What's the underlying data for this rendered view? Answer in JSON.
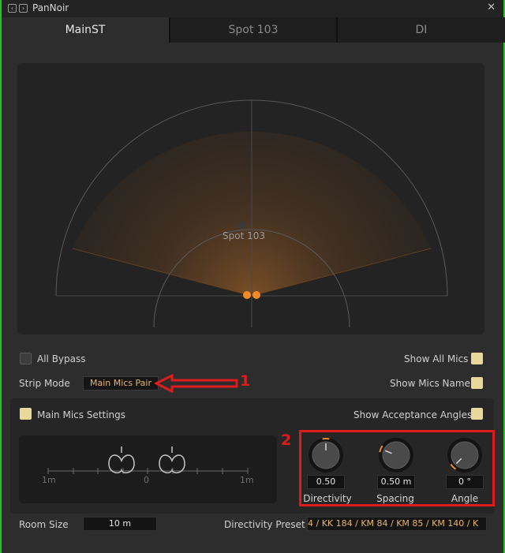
{
  "window": {
    "title": "PanNoir",
    "close_glyph": "✕",
    "nav_prev_glyph": "‹",
    "nav_next_glyph": "›"
  },
  "tabs": [
    {
      "label": "MainST",
      "active": true
    },
    {
      "label": "Spot 103",
      "active": false
    },
    {
      "label": "DI",
      "active": false
    }
  ],
  "panner": {
    "spot_label": "Spot 103",
    "accent_color": "#f08a2a"
  },
  "controls": {
    "all_bypass": {
      "label": "All Bypass",
      "checked": false
    },
    "show_all_mics": {
      "label": "Show All Mics",
      "checked": true
    },
    "strip_mode": {
      "label": "Strip Mode",
      "value": "Main Mics Pair"
    },
    "show_mics_name": {
      "label": "Show Mics Name",
      "checked": true
    },
    "main_mics_settings": {
      "label": "Main Mics Settings",
      "checked": true
    },
    "show_acceptance_angles": {
      "label": "Show Acceptance Angles",
      "checked": true
    }
  },
  "spacing_scale": {
    "left_label": "1m",
    "center_label": "0",
    "right_label": "1m"
  },
  "knobs": [
    {
      "label": "Directivity",
      "value": "0.50",
      "level": 0.5
    },
    {
      "label": "Spacing",
      "value": "0.50 m",
      "level": 0.25
    },
    {
      "label": "Angle",
      "value": "0 °",
      "level": 0.0
    }
  ],
  "room_size": {
    "label": "Room Size",
    "value": "10 m"
  },
  "directivity_preset": {
    "label": "Directivity Preset",
    "value": "4 / KK 184 / KM 84 / KM 85 / KM 140 / K"
  },
  "annotations": {
    "marker_1": "1",
    "marker_2": "2"
  }
}
